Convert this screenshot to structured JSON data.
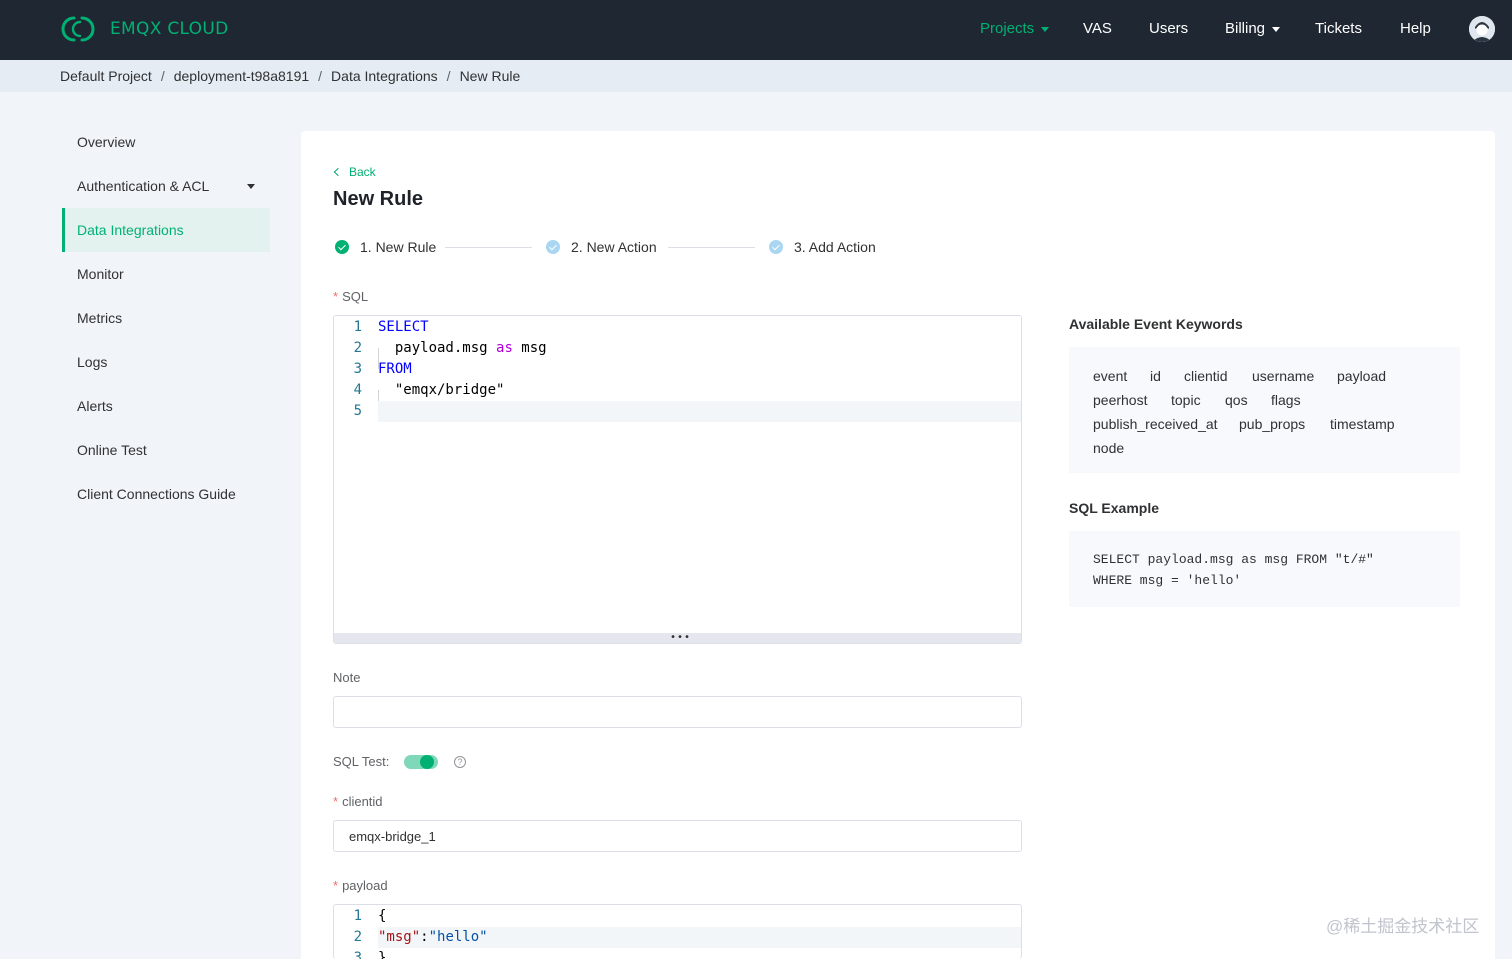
{
  "header": {
    "brand": "EMQX CLOUD",
    "nav": [
      {
        "label": "Projects",
        "dropdown": true,
        "active": true
      },
      {
        "label": "VAS",
        "dropdown": false,
        "active": false
      },
      {
        "label": "Users",
        "dropdown": false,
        "active": false
      },
      {
        "label": "Billing",
        "dropdown": true,
        "active": false
      },
      {
        "label": "Tickets",
        "dropdown": false,
        "active": false
      },
      {
        "label": "Help",
        "dropdown": false,
        "active": false
      }
    ],
    "avatar_icon": "user-avatar-icon"
  },
  "breadcrumb": [
    "Default Project",
    "deployment-t98a8191",
    "Data Integrations",
    "New Rule"
  ],
  "sidebar": {
    "items": [
      {
        "label": "Overview"
      },
      {
        "label": "Authentication & ACL",
        "dropdown": true
      },
      {
        "label": "Data Integrations",
        "active": true
      },
      {
        "label": "Monitor"
      },
      {
        "label": "Metrics"
      },
      {
        "label": "Logs"
      },
      {
        "label": "Alerts"
      },
      {
        "label": "Online Test"
      },
      {
        "label": "Client Connections Guide"
      }
    ]
  },
  "main": {
    "back_label": "Back",
    "title": "New Rule",
    "steps": [
      {
        "label": "1. New Rule",
        "status": "done"
      },
      {
        "label": "2. New Action",
        "status": "pending"
      },
      {
        "label": "3. Add Action",
        "status": "pending"
      }
    ],
    "sql_label": "SQL",
    "sql_lines": [
      {
        "n": "1",
        "tokens": [
          {
            "t": "SELECT",
            "c": "kw"
          }
        ]
      },
      {
        "n": "2",
        "tokens": [
          {
            "t": "  payload.msg ",
            "c": ""
          },
          {
            "t": "as",
            "c": "kw2"
          },
          {
            "t": " msg",
            "c": ""
          }
        ]
      },
      {
        "n": "3",
        "tokens": [
          {
            "t": "FROM",
            "c": "kw"
          }
        ]
      },
      {
        "n": "4",
        "tokens": [
          {
            "t": "  \"emqx/bridge\"",
            "c": ""
          }
        ]
      },
      {
        "n": "5",
        "tokens": []
      }
    ],
    "note_label": "Note",
    "note_value": "",
    "sql_test_label": "SQL Test:",
    "sql_test_enabled": true,
    "clientid_label": "clientid",
    "clientid_value": "emqx-bridge_1",
    "payload_label": "payload",
    "payload_lines": [
      {
        "n": "1",
        "tokens": [
          {
            "t": "{",
            "c": ""
          }
        ]
      },
      {
        "n": "2",
        "tokens": [
          {
            "t": "\"msg\"",
            "c": "str"
          },
          {
            "t": ":",
            "c": ""
          },
          {
            "t": "\"hello\"",
            "c": "strv"
          }
        ]
      },
      {
        "n": "3",
        "tokens": [
          {
            "t": "}",
            "c": ""
          }
        ]
      }
    ]
  },
  "right_panel": {
    "keywords_title": "Available Event Keywords",
    "keyword_rows": [
      [
        "event",
        "id",
        "clientid",
        "username",
        "payload"
      ],
      [
        "peerhost",
        "topic",
        "qos",
        "flags"
      ],
      [
        "publish_received_at",
        "pub_props",
        "timestamp"
      ],
      [
        "node"
      ]
    ],
    "example_title": "SQL Example",
    "example_lines": [
      "SELECT payload.msg as msg FROM \"t/#\"",
      "WHERE msg = 'hello'"
    ]
  },
  "watermark": "@稀土掘金技术社区",
  "colors": {
    "brand": "#00b173",
    "topbar": "#1e2732",
    "pending_step": "#a9d6f0"
  }
}
